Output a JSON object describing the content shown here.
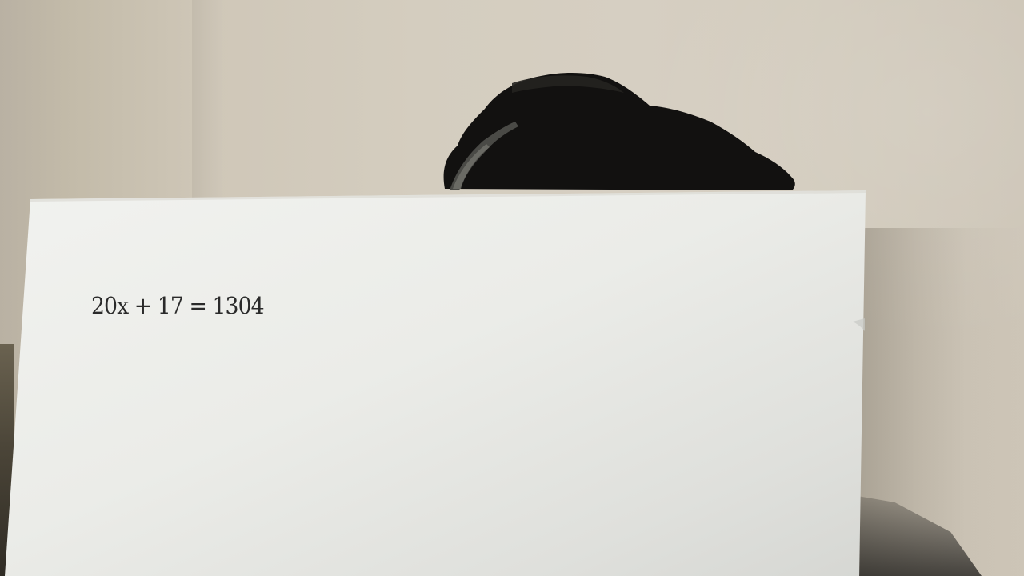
{
  "paper": {
    "equation": "20x + 17 = 1304"
  }
}
